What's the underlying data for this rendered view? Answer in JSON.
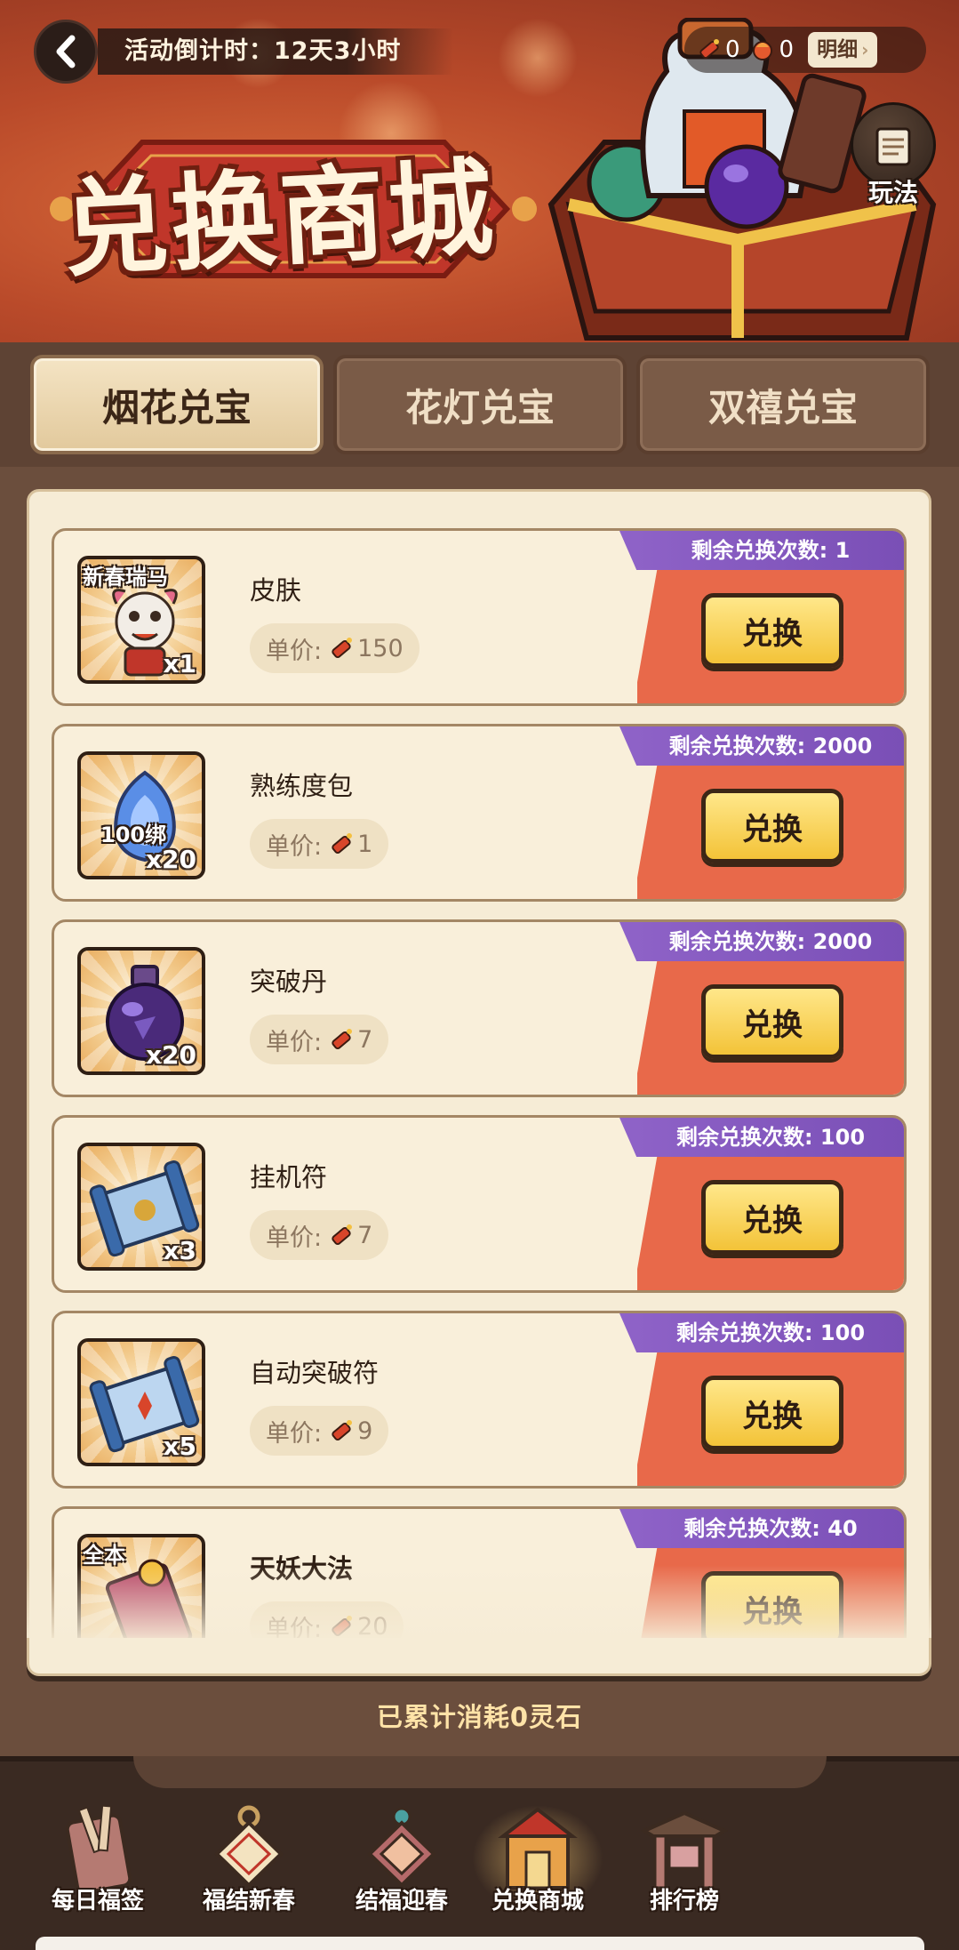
{
  "header": {
    "countdown": "活动倒计时：12天3小时",
    "title": "兑换商城",
    "currency": [
      {
        "name": "firecracker",
        "value": "0"
      },
      {
        "name": "lantern",
        "value": "0"
      }
    ],
    "detail_label": "明细",
    "rules_label": "玩法"
  },
  "tabs": [
    {
      "label": "烟花兑宝",
      "active": true
    },
    {
      "label": "花灯兑宝",
      "active": false
    },
    {
      "label": "双禧兑宝",
      "active": false
    }
  ],
  "price_prefix": "单价:",
  "exchange_label": "兑换",
  "items": [
    {
      "name": "皮肤",
      "price": "150",
      "remain": "剩余兑换次数:  1",
      "qty": "x1",
      "tag": "新春瑞马",
      "icon": "lion-dance-skin-icon"
    },
    {
      "name": "熟练度包",
      "price": "1",
      "remain": "剩余兑换次数:  2000",
      "qty": "x20",
      "tag": "100绑",
      "icon": "blue-flame-icon"
    },
    {
      "name": "突破丹",
      "price": "7",
      "remain": "剩余兑换次数:  2000",
      "qty": "x20",
      "tag": "",
      "icon": "purple-potion-icon"
    },
    {
      "name": "挂机符",
      "price": "7",
      "remain": "剩余兑换次数:  100",
      "qty": "x3",
      "tag": "",
      "icon": "idle-scroll-icon"
    },
    {
      "name": "自动突破符",
      "price": "9",
      "remain": "剩余兑换次数:  100",
      "qty": "x5",
      "tag": "",
      "icon": "breakthrough-scroll-icon"
    },
    {
      "name": "天妖大法",
      "price": "20",
      "remain": "剩余兑换次数:  40",
      "qty": "",
      "tag": "全本",
      "icon": "skill-book-icon"
    }
  ],
  "footer_text": "已累计消耗0灵石",
  "nav": [
    {
      "label": "每日福签",
      "icon": "fortune-stick-icon",
      "active": false
    },
    {
      "label": "福结新春",
      "icon": "lucky-knot-icon",
      "active": false
    },
    {
      "label": "结福迎春",
      "icon": "blessing-knot-icon",
      "active": false
    },
    {
      "label": "兑换商城",
      "icon": "shop-icon",
      "active": true
    },
    {
      "label": "排行榜",
      "icon": "ranking-gate-icon",
      "active": false
    }
  ],
  "colors": {
    "accent_orange": "#e8694a",
    "remain_purple": "#8f63c8",
    "button_yellow": "#f3c338",
    "panel_cream": "#f6ecd6"
  }
}
